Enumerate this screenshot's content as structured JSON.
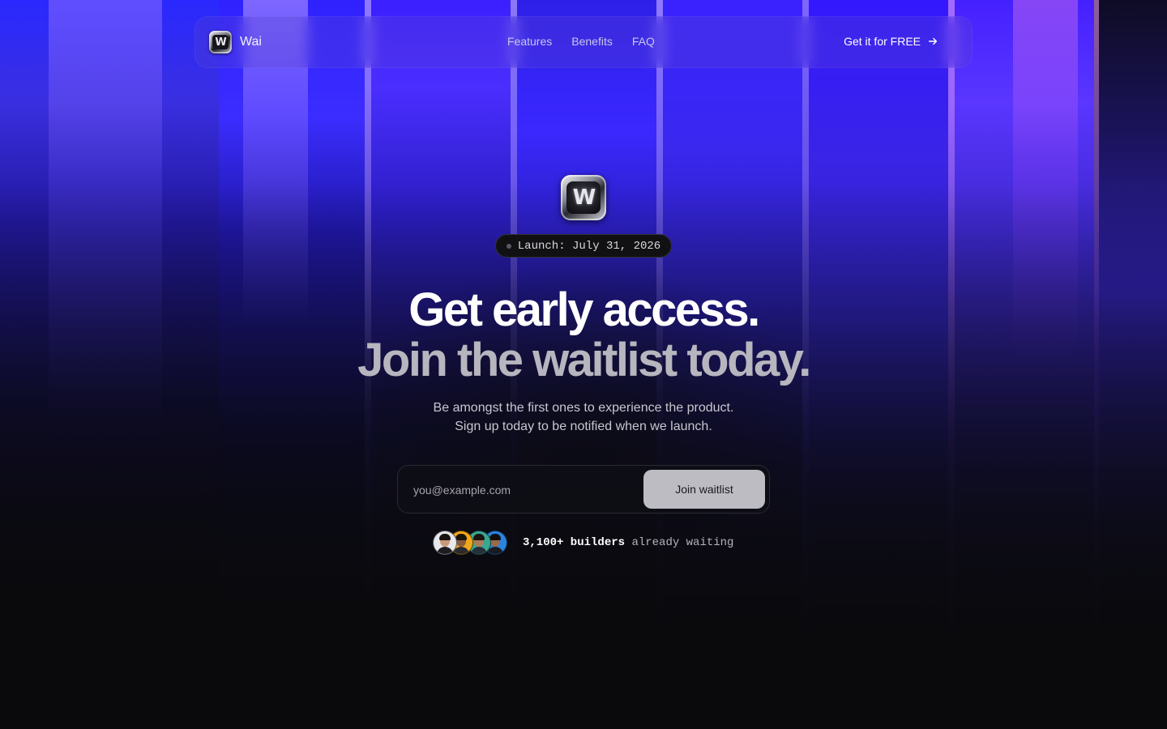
{
  "nav": {
    "brand_name": "Wai",
    "brand_logo_text": "W",
    "links": [
      "Features",
      "Benefits",
      "FAQ"
    ],
    "cta_label": "Get it for FREE"
  },
  "hero": {
    "logo_text": "W",
    "badge": "Launch: July 31, 2026",
    "title_line1": "Get early access.",
    "title_line2": "Join the waitlist today.",
    "subtitle_line1": "Be amongst the first ones to experience the product.",
    "subtitle_line2": "Sign up today to be notified when we launch."
  },
  "form": {
    "email_placeholder": "you@example.com",
    "submit_label": "Join waitlist"
  },
  "social_proof": {
    "count_text": "3,100+ builders",
    "suffix_text": "already waiting",
    "avatar_count": 4
  },
  "colors": {
    "background": "#0a0a0c",
    "accent_blue": "#2a1cff",
    "accent_violet": "#7a5cff",
    "button_bg": "#bdbcc3"
  }
}
